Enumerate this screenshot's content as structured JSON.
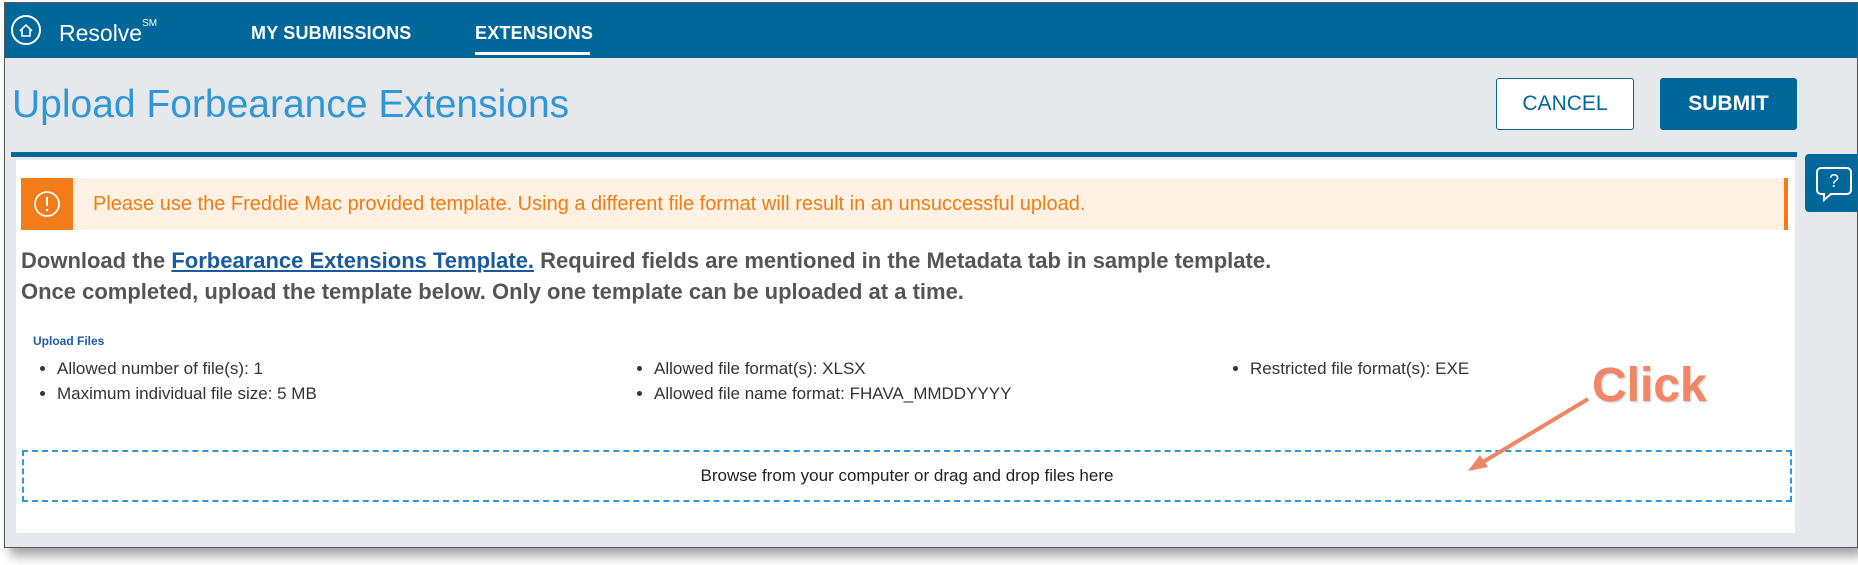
{
  "header": {
    "brand": "Resolve",
    "brand_mark": "SM",
    "tabs": [
      {
        "label": "MY SUBMISSIONS",
        "active": false
      },
      {
        "label": "EXTENSIONS",
        "active": true
      }
    ]
  },
  "page": {
    "title": "Upload Forbearance Extensions",
    "cancel_label": "CANCEL",
    "submit_label": "SUBMIT"
  },
  "warning": {
    "text": "Please use the Freddie Mac provided template. Using a different file format will result in an unsuccessful upload."
  },
  "intro": {
    "prefix": "Download the ",
    "link": "Forbearance Extensions Template.",
    "suffix": " Required fields are mentioned in the Metadata tab in sample template.",
    "line2": "Once completed, upload the template below. Only one template can be uploaded at a time."
  },
  "upload": {
    "label": "Upload Files",
    "col1": [
      "Allowed number of file(s): 1",
      "Maximum individual file size: 5 MB"
    ],
    "col2": [
      "Allowed file format(s): XLSX",
      "Allowed file name format: FHAVA_MMDDYYYY"
    ],
    "col3": [
      "Restricted file format(s): EXE"
    ],
    "dropzone_text": "Browse from your computer or drag and drop files here"
  },
  "annotation": {
    "text": "Click"
  },
  "colors": {
    "brand": "#00679a",
    "title": "#2e97d8",
    "warning": "#f07c12",
    "annotation": "#f08665"
  },
  "icons": [
    "home-logo-icon",
    "help-icon",
    "warning-icon"
  ]
}
